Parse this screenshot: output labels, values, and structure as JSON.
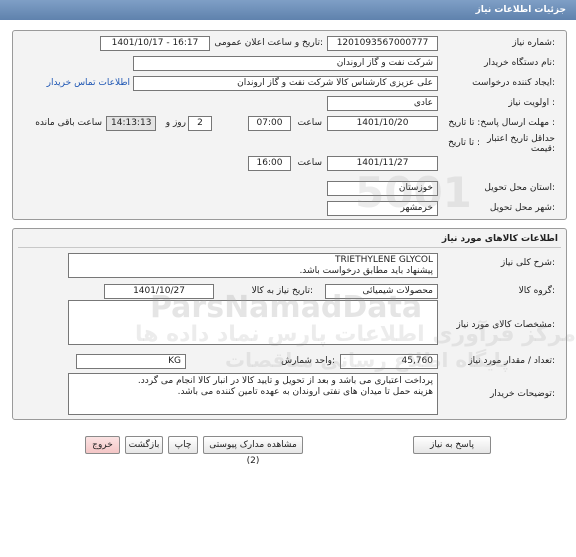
{
  "window": {
    "title": "جزئیات اطلاعات نیاز"
  },
  "request": {
    "number_label": "شماره نیاز:",
    "number_value": "1201093567000777",
    "announce_label": "تاریخ و ساعت اعلان عمومی:",
    "announce_value": "1401/10/17 - 16:17",
    "buyer_label": "نام دستگاه خریدار:",
    "buyer_value": "شرکت نفت و گاز اروندان",
    "creator_label": "ایجاد کننده درخواست:",
    "creator_value": "علی عزیزی کارشناس کالا شرکت نفت و گاز اروندان",
    "contact_link": "اطلاعات تماس خریدار",
    "priority_label": "اولویت نیاز :",
    "priority_value": "عادی",
    "deadline_label": "مهلت ارسال پاسخ: تا تاریخ :",
    "deadline_date": "1401/10/20",
    "deadline_time_label": "ساعت",
    "deadline_time": "07:00",
    "days_value": "2",
    "days_label": "روز و",
    "remaining_time": "14:13:13",
    "remaining_label": "ساعت باقی مانده",
    "validity_label_1": "حداقل تاریخ اعتبار",
    "validity_label_2": "قیمت:",
    "validity_to_label": "تا تاریخ :",
    "validity_date": "1401/11/27",
    "validity_time_label": "ساعت",
    "validity_time": "16:00",
    "province_label": "استان محل تحویل:",
    "province_value": "خوزستان",
    "city_label": "شهر محل تحویل:",
    "city_value": "خرمشهر"
  },
  "goods": {
    "section_title": "اطلاعات کالاهای مورد نیاز",
    "summary_label": "شرح کلی نیاز:",
    "summary_line1": "TRIETHYLENE GLYCOL",
    "summary_line2": "پیشنهاد باید مطابق درخواست باشد.",
    "group_label": "گروه کالا:",
    "group_value": "محصولات شیمیائی",
    "need_date_label": "تاریخ نیاز به کالا:",
    "need_date_value": "1401/10/27",
    "specs_label": "مشخصات کالای مورد نیاز:",
    "qty_label": "تعداد / مقدار مورد نیاز:",
    "qty_value": "45,760",
    "unit_label": "واحد شمارش:",
    "unit_value": "KG",
    "notes_label": "توضیحات خریدار:",
    "notes_line1": "پرداخت اعتباری می باشد و  بعد از تحویل و تایید کالا در انبار کالا انجام می گردد.",
    "notes_line2": "هزینه حمل تا میدان های نفتی اروندان به عهده تامین کننده می باشد."
  },
  "buttons": {
    "reply": "پاسخ به نیاز",
    "attachments": "مشاهده مدارک پیوستی (2)",
    "print": "چاپ",
    "back": "بازگشت",
    "exit": "خروج"
  },
  "watermark": {
    "brand_latin": "ParsNamadData",
    "brand_persian": "مرکز فرآوری اطلاعات پارس نماد داده ها",
    "bank_persian": "پایگاه اطلاع رسانی مناقصات",
    "phone_fragment": "5001"
  },
  "colors": {
    "title_bar": "#6b8cb6",
    "panel_bg": "#f3f3f3",
    "link": "#1f57b4",
    "exit_button": "#f4c6c6"
  }
}
